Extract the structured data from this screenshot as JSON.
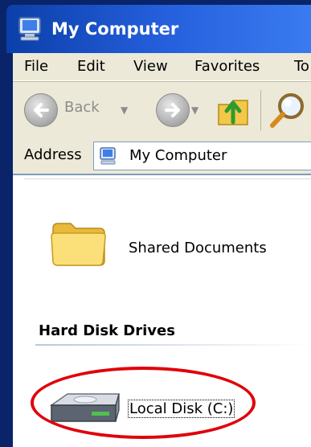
{
  "window": {
    "title": "My Computer"
  },
  "menu": [
    "File",
    "Edit",
    "View",
    "Favorites",
    "To"
  ],
  "toolbar": {
    "back_label": "Back"
  },
  "address": {
    "label": "Address",
    "value": "My Computer"
  },
  "content": {
    "shared_documents": "Shared Documents",
    "section_title": "Hard Disk Drives",
    "drive_label": "Local Disk (C:)"
  },
  "colors": {
    "titlebar": "#245edb",
    "chrome": "#ece9d8",
    "highlight": "#e0000a"
  }
}
